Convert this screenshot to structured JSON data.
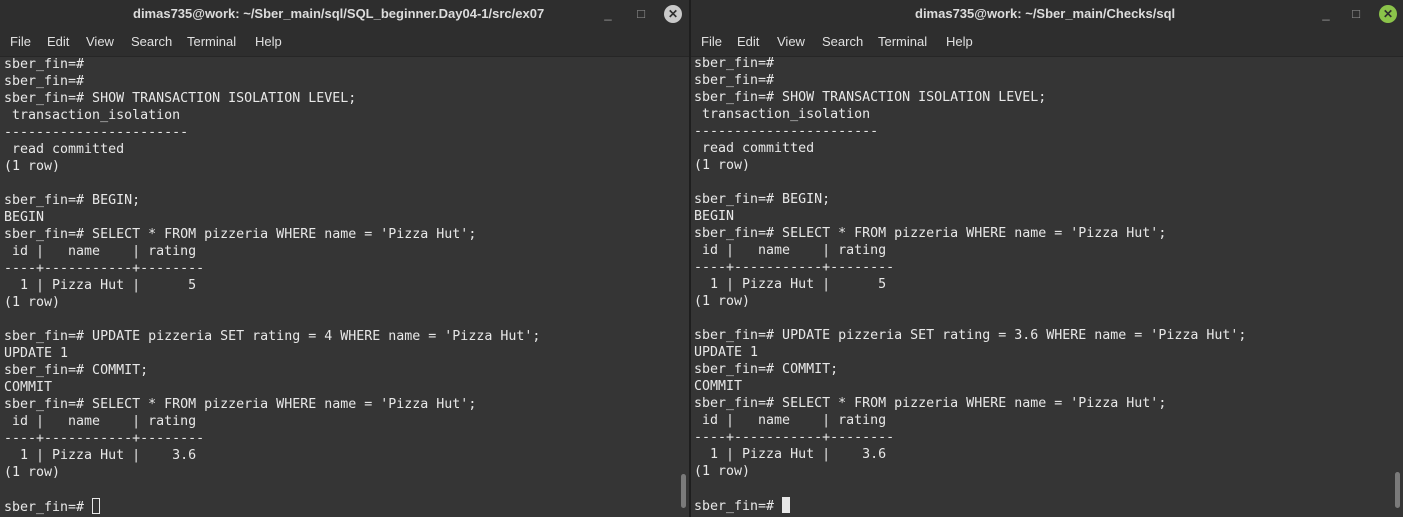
{
  "left_window": {
    "title": "dimas735@work: ~/Sber_main/sql/SQL_beginner.Day04-1/src/ex07",
    "controls": {
      "minimize": "_",
      "maximize": "□",
      "close": "✕"
    },
    "menu": [
      "File",
      "Edit",
      "View",
      "Search",
      "Terminal",
      "Help"
    ],
    "lines": [
      "sber_fin=#",
      "sber_fin=#",
      "sber_fin=# SHOW TRANSACTION ISOLATION LEVEL;",
      " transaction_isolation",
      "-----------------------",
      " read committed",
      "(1 row)",
      "",
      "sber_fin=# BEGIN;",
      "BEGIN",
      "sber_fin=# SELECT * FROM pizzeria WHERE name = 'Pizza Hut';",
      " id |   name    | rating",
      "----+-----------+--------",
      "  1 | Pizza Hut |      5",
      "(1 row)",
      "",
      "sber_fin=# UPDATE pizzeria SET rating = 4 WHERE name = 'Pizza Hut';",
      "UPDATE 1",
      "sber_fin=# COMMIT;",
      "COMMIT",
      "sber_fin=# SELECT * FROM pizzeria WHERE name = 'Pizza Hut';",
      " id |   name    | rating",
      "----+-----------+--------",
      "  1 | Pizza Hut |    3.6",
      "(1 row)",
      ""
    ],
    "prompt": "sber_fin=# "
  },
  "right_window": {
    "title": "dimas735@work: ~/Sber_main/Checks/sql",
    "controls": {
      "minimize": "_",
      "maximize": "□",
      "close": "✕"
    },
    "menu": [
      "File",
      "Edit",
      "View",
      "Search",
      "Terminal",
      "Help"
    ],
    "lines": [
      "sber_fin=#",
      "sber_fin=#",
      "sber_fin=# SHOW TRANSACTION ISOLATION LEVEL;",
      " transaction_isolation",
      "-----------------------",
      " read committed",
      "(1 row)",
      "",
      "sber_fin=# BEGIN;",
      "BEGIN",
      "sber_fin=# SELECT * FROM pizzeria WHERE name = 'Pizza Hut';",
      " id |   name    | rating",
      "----+-----------+--------",
      "  1 | Pizza Hut |      5",
      "(1 row)",
      "",
      "sber_fin=# UPDATE pizzeria SET rating = 3.6 WHERE name = 'Pizza Hut';",
      "UPDATE 1",
      "sber_fin=# COMMIT;",
      "COMMIT",
      "sber_fin=# SELECT * FROM pizzeria WHERE name = 'Pizza Hut';",
      " id |   name    | rating",
      "----+-----------+--------",
      "  1 | Pizza Hut |    3.6",
      "(1 row)",
      ""
    ],
    "prompt": "sber_fin=# "
  }
}
